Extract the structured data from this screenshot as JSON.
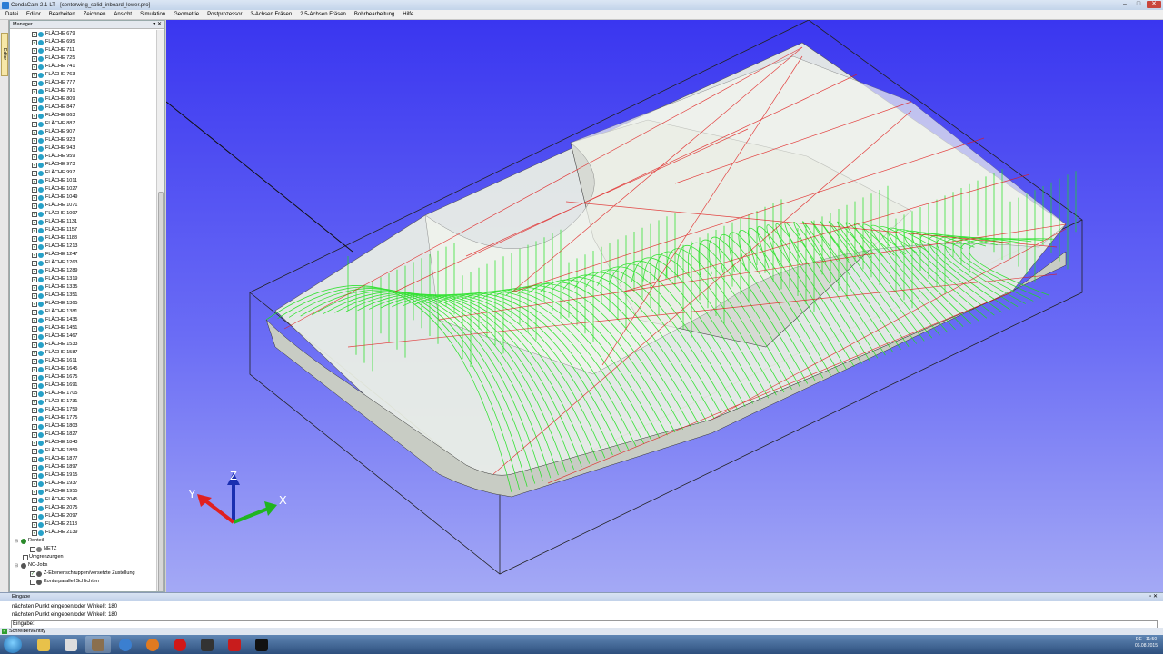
{
  "window": {
    "title": "CondaCam 2.1-LT - [centerwing_solid_inboard_lower.pro]",
    "minimize": "–",
    "maximize": "□",
    "close": "✕"
  },
  "menu": [
    "Datei",
    "Editor",
    "Bearbeiten",
    "Zeichnen",
    "Ansicht",
    "Simulation",
    "Geometrie",
    "Postprozessor",
    "3-Achsen Fräsen",
    "2.5-Achsen Fräsen",
    "Bohrbearbeitung",
    "Hilfe"
  ],
  "sidetab": "Editor",
  "manager": {
    "title": "Manager",
    "pin": "▾ ✕",
    "surfaces": [
      "FLÄCHE 679",
      "FLÄCHE 695",
      "FLÄCHE 711",
      "FLÄCHE 725",
      "FLÄCHE 741",
      "FLÄCHE 763",
      "FLÄCHE 777",
      "FLÄCHE 791",
      "FLÄCHE 809",
      "FLÄCHE 847",
      "FLÄCHE 863",
      "FLÄCHE 887",
      "FLÄCHE 907",
      "FLÄCHE 923",
      "FLÄCHE 943",
      "FLÄCHE 959",
      "FLÄCHE 973",
      "FLÄCHE 997",
      "FLÄCHE 1011",
      "FLÄCHE 1027",
      "FLÄCHE 1049",
      "FLÄCHE 1071",
      "FLÄCHE 1097",
      "FLÄCHE 1131",
      "FLÄCHE 1157",
      "FLÄCHE 1183",
      "FLÄCHE 1213",
      "FLÄCHE 1247",
      "FLÄCHE 1263",
      "FLÄCHE 1289",
      "FLÄCHE 1319",
      "FLÄCHE 1335",
      "FLÄCHE 1351",
      "FLÄCHE 1365",
      "FLÄCHE 1381",
      "FLÄCHE 1435",
      "FLÄCHE 1451",
      "FLÄCHE 1467",
      "FLÄCHE 1533",
      "FLÄCHE 1587",
      "FLÄCHE 1611",
      "FLÄCHE 1645",
      "FLÄCHE 1675",
      "FLÄCHE 1691",
      "FLÄCHE 1705",
      "FLÄCHE 1731",
      "FLÄCHE 1759",
      "FLÄCHE 1775",
      "FLÄCHE 1803",
      "FLÄCHE 1827",
      "FLÄCHE 1843",
      "FLÄCHE 1859",
      "FLÄCHE 1877",
      "FLÄCHE 1897",
      "FLÄCHE 1915",
      "FLÄCHE 1937",
      "FLÄCHE 1955",
      "FLÄCHE 2045",
      "FLÄCHE 2075",
      "FLÄCHE 2097",
      "FLÄCHE 2113",
      "FLÄCHE 2139"
    ],
    "rohteil": "Rohteil",
    "netz": "NETZ",
    "umgrenzungen": "Umgrenzungen",
    "ncjobs": "NC-Jobs",
    "jobs": [
      "Z-Ebenenschruppen/versetzte Zustellung",
      "Konturparallel Schlichten"
    ]
  },
  "viewport": {
    "bg_top": "#3a36f0",
    "bg_bottom": "#a4a9f5",
    "axis_x": "X",
    "axis_y": "Y",
    "axis_z": "Z",
    "color_x": "#1fb51f",
    "color_y": "#e02020",
    "color_z": "#1a2fb0",
    "toolpath_green": "#18e018",
    "toolpath_red": "#e01818"
  },
  "eingabe": {
    "title": "Eingabe",
    "lines": [
      "nächsten Punkt eingeben/oder Winkel!: 180",
      "nächsten Punkt eingeben/oder Winkel!: 180"
    ],
    "prompt": "Eingabe:"
  },
  "status": {
    "text": "Schreiben/Entity"
  },
  "taskbar": {
    "lang": "DE",
    "time": "11:50",
    "date": "06.08.2015"
  }
}
